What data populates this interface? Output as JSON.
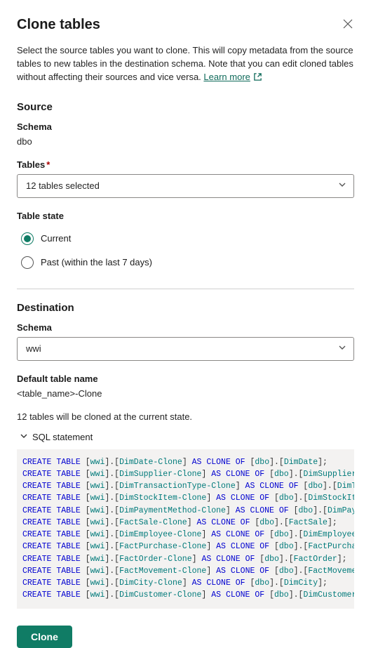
{
  "header": {
    "title": "Clone tables",
    "close_icon": "close-icon"
  },
  "intro": {
    "text": "Select the source tables you want to clone. This will copy metadata from the source tables to new tables in the destination schema. Note that you can edit cloned tables without affecting their sources and vice versa. ",
    "learn_more": "Learn more"
  },
  "source": {
    "heading": "Source",
    "schema_label": "Schema",
    "schema_value": "dbo",
    "tables_label": "Tables",
    "tables_required": "*",
    "tables_selected": "12 tables selected",
    "state_label": "Table state",
    "state_current": "Current",
    "state_past": "Past (within the last 7 days)"
  },
  "destination": {
    "heading": "Destination",
    "schema_label": "Schema",
    "schema_value": "wwi",
    "default_name_label": "Default table name",
    "default_name_value": "<table_name>-Clone"
  },
  "summary": "12 tables will be cloned at the current state.",
  "sql": {
    "toggle_label": "SQL statement",
    "statements": [
      {
        "dst_schema": "wwi",
        "dst_table": "DimDate-Clone",
        "src_schema": "dbo",
        "src_table": "DimDate"
      },
      {
        "dst_schema": "wwi",
        "dst_table": "DimSupplier-Clone",
        "src_schema": "dbo",
        "src_table": "DimSupplier"
      },
      {
        "dst_schema": "wwi",
        "dst_table": "DimTransactionType-Clone",
        "src_schema": "dbo",
        "src_table": "DimTra"
      },
      {
        "dst_schema": "wwi",
        "dst_table": "DimStockItem-Clone",
        "src_schema": "dbo",
        "src_table": "DimStockItem"
      },
      {
        "dst_schema": "wwi",
        "dst_table": "DimPaymentMethod-Clone",
        "src_schema": "dbo",
        "src_table": "DimPayme"
      },
      {
        "dst_schema": "wwi",
        "dst_table": "FactSale-Clone",
        "src_schema": "dbo",
        "src_table": "FactSale"
      },
      {
        "dst_schema": "wwi",
        "dst_table": "DimEmployee-Clone",
        "src_schema": "dbo",
        "src_table": "DimEmployee"
      },
      {
        "dst_schema": "wwi",
        "dst_table": "FactPurchase-Clone",
        "src_schema": "dbo",
        "src_table": "FactPurchase"
      },
      {
        "dst_schema": "wwi",
        "dst_table": "FactOrder-Clone",
        "src_schema": "dbo",
        "src_table": "FactOrder"
      },
      {
        "dst_schema": "wwi",
        "dst_table": "FactMovement-Clone",
        "src_schema": "dbo",
        "src_table": "FactMovement"
      },
      {
        "dst_schema": "wwi",
        "dst_table": "DimCity-Clone",
        "src_schema": "dbo",
        "src_table": "DimCity"
      },
      {
        "dst_schema": "wwi",
        "dst_table": "DimCustomer-Clone",
        "src_schema": "dbo",
        "src_table": "DimCustomer"
      }
    ]
  },
  "buttons": {
    "clone": "Clone"
  }
}
